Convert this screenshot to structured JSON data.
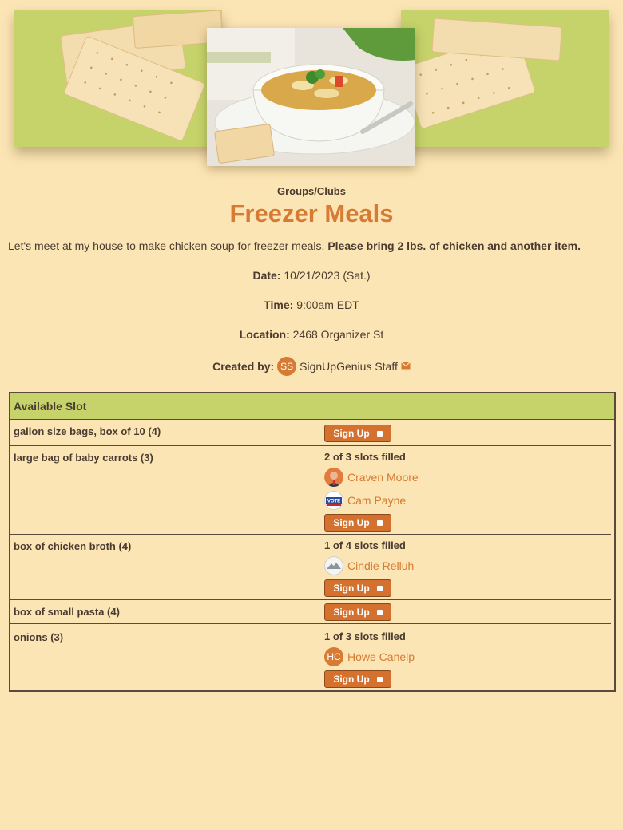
{
  "event": {
    "category": "Groups/Clubs",
    "title": "Freezer Meals",
    "description": "Let's meet at my house to make chicken soup for freezer meals.",
    "description_bold": "Please bring 2 lbs. of chicken and another item.",
    "date_label": "Date:",
    "date_value": "10/21/2023 (Sat.)",
    "time_label": "Time:",
    "time_value": "9:00am EDT",
    "location_label": "Location:",
    "location_value": "2468 Organizer St",
    "created_label": "Created by:",
    "creator_initials": "SS",
    "creator_name": "SignUpGenius Staff"
  },
  "table": {
    "header": "Available Slot",
    "signup_label": "Sign Up",
    "rows": [
      {
        "item": "gallon size bags, box of 10 (4)",
        "filled": "",
        "people": []
      },
      {
        "item": "large bag of baby carrots (3)",
        "filled": "2 of 3 slots filled",
        "people": [
          {
            "name": "Craven Moore",
            "avatar": "photo-portrait"
          },
          {
            "name": "Cam Payne",
            "avatar": "vote-badge"
          }
        ]
      },
      {
        "item": "box of chicken broth (4)",
        "filled": "1 of 4 slots filled",
        "people": [
          {
            "name": "Cindie Relluh",
            "avatar": "mountain-photo"
          }
        ]
      },
      {
        "item": "box of small pasta (4)",
        "filled": "",
        "people": []
      },
      {
        "item": "onions (3)",
        "filled": "1 of 3 slots filled",
        "people": [
          {
            "name": "Howe Canelp",
            "avatar": "initials",
            "initials": "HC"
          }
        ]
      }
    ]
  },
  "colors": {
    "background": "#fce5b5",
    "accent": "#d67a34",
    "header_green": "#c5d36a",
    "button": "#d4712e"
  }
}
